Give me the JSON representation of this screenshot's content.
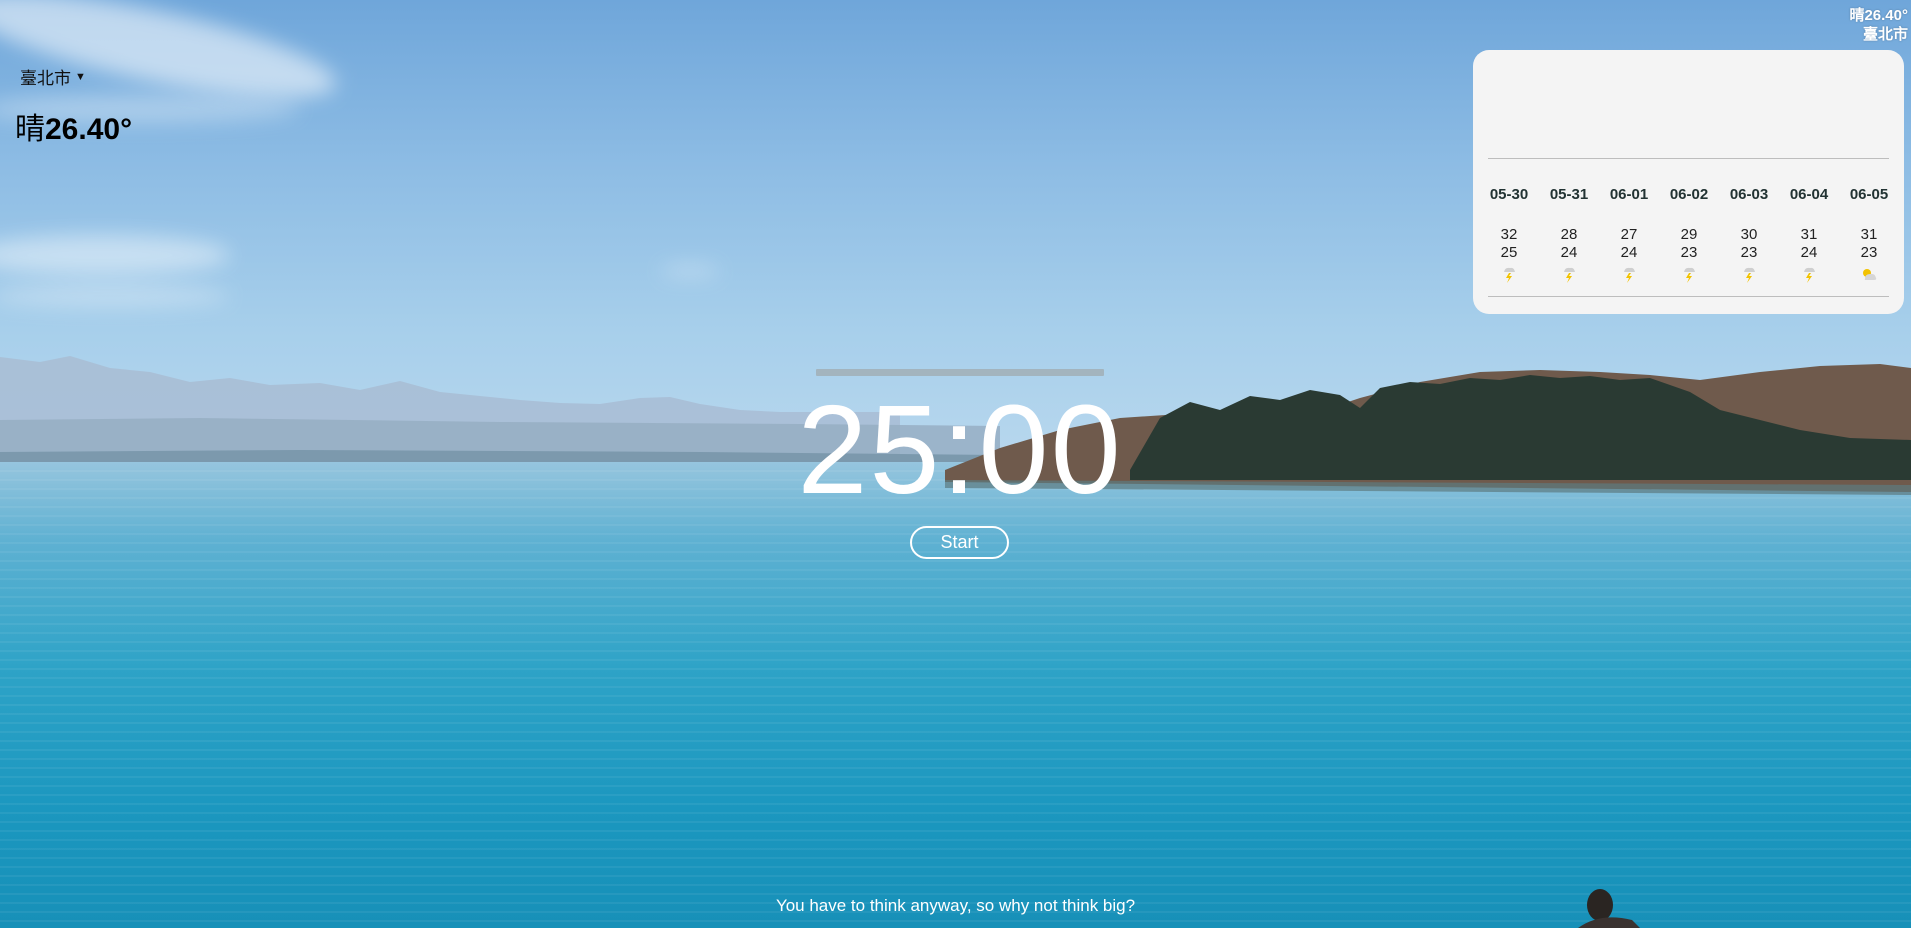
{
  "header_weather": {
    "condition_temp": "晴26.40°",
    "city": "臺北市"
  },
  "weather_card": {
    "city_select": "臺北市",
    "current_condition": "晴",
    "current_temp": "26.40°",
    "forecast": [
      {
        "date": "05-30",
        "high": "32",
        "low": "25",
        "icon": "thunder-rain-icon"
      },
      {
        "date": "05-31",
        "high": "28",
        "low": "24",
        "icon": "thunder-rain-icon"
      },
      {
        "date": "06-01",
        "high": "27",
        "low": "24",
        "icon": "thunder-rain-icon"
      },
      {
        "date": "06-02",
        "high": "29",
        "low": "23",
        "icon": "thunder-rain-icon"
      },
      {
        "date": "06-03",
        "high": "30",
        "low": "23",
        "icon": "thunder-rain-icon"
      },
      {
        "date": "06-04",
        "high": "31",
        "low": "24",
        "icon": "thunder-rain-icon"
      },
      {
        "date": "06-05",
        "high": "31",
        "low": "23",
        "icon": "partly-cloudy-rain-icon"
      }
    ]
  },
  "pomodoro": {
    "time": "25:00",
    "start_label": "Start",
    "progress": 0
  },
  "quote": "You have to think anyway, so why not think big?"
}
